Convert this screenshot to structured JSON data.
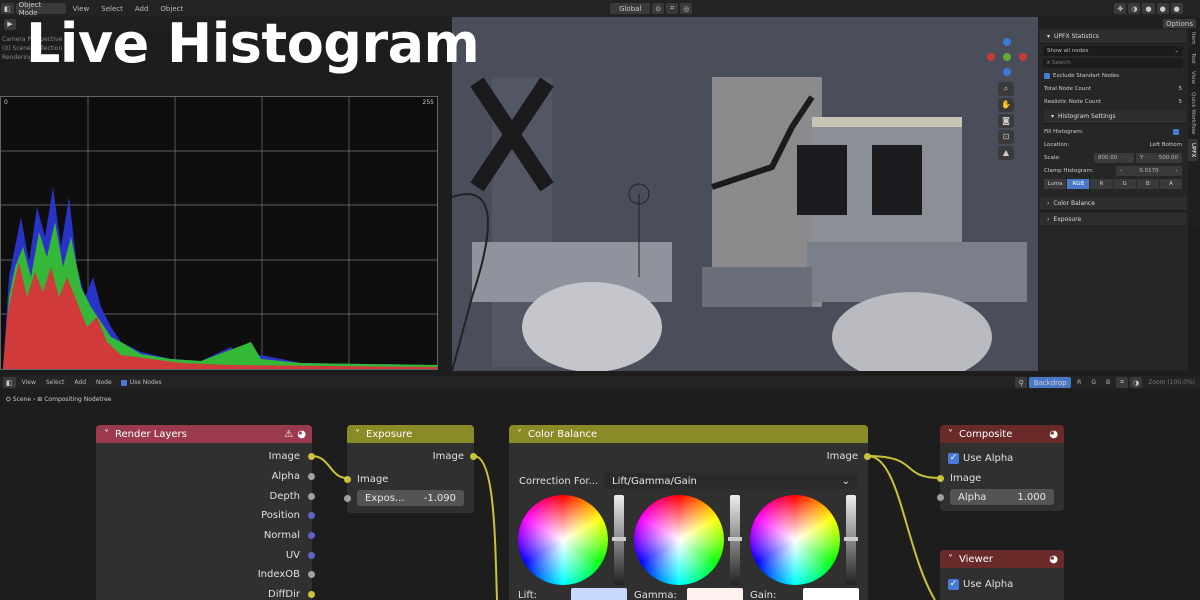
{
  "header": {
    "mode": "Object Mode",
    "menu": [
      "View",
      "Select",
      "Add",
      "Object"
    ],
    "orientation": "Global",
    "options": "Options"
  },
  "overlay": {
    "line1": "Camera Perspective",
    "line2": "(0) Scene Collection |",
    "line3": "Rendering"
  },
  "title": "Live Histogram",
  "histogram": {
    "min": "0",
    "max": "255"
  },
  "npanel": {
    "title": "UPFX Statistics",
    "show": "Show all nodes",
    "search_placeholder": "Search",
    "exclude": "Exclude Standart Nodes",
    "total_label": "Total Node Count",
    "total_value": "5",
    "real_label": "Realistic Node Count",
    "real_value": "5",
    "hist_settings": "Histogram Settings",
    "fill": "Fill Histogram:",
    "location_label": "Location:",
    "location_value": "Left Bottom",
    "scale_label": "Scale:",
    "scale_x": "800.00",
    "scale_y_label": "Y",
    "scale_y": "500.00",
    "clamp_label": "Clamp Histogram:",
    "clamp_value": "0.0170",
    "tabs": [
      "Luma",
      "RGB",
      "R",
      "G",
      "B",
      "A"
    ],
    "color_balance": "Color Balance",
    "exposure": "Exposure",
    "vtabs": [
      "Item",
      "Tool",
      "View",
      "Quick Workflow",
      "UPFX"
    ]
  },
  "node_header": {
    "menu": [
      "View",
      "Select",
      "Add",
      "Node"
    ],
    "use_nodes": "Use Nodes",
    "backdrop": "Backdrop",
    "channels": [
      "R",
      "G",
      "B"
    ],
    "zoom": "Zoom (100.0%)"
  },
  "breadcrumb": {
    "scene": "Scene",
    "tree": "Compositing Nodetree"
  },
  "nodes": {
    "render_layers": {
      "title": "Render Layers",
      "outputs": [
        "Image",
        "Alpha",
        "Depth",
        "Position",
        "Normal",
        "UV",
        "IndexOB",
        "DiffDir"
      ]
    },
    "exposure": {
      "title": "Exposure",
      "out": "Image",
      "in": "Image",
      "field_label": "Expos...",
      "field_value": "-1.090"
    },
    "color_balance": {
      "title": "Color Balance",
      "out": "Image",
      "corr_label": "Correction For...",
      "corr_value": "Lift/Gamma/Gain",
      "lift": "Lift:",
      "gamma": "Gamma:",
      "gain": "Gain:"
    },
    "composite": {
      "title": "Composite",
      "use_alpha": "Use Alpha",
      "in": "Image",
      "alpha_label": "Alpha",
      "alpha_value": "1.000"
    },
    "viewer": {
      "title": "Viewer",
      "use_alpha": "Use Alpha"
    }
  },
  "colors": {
    "render_layers": "#9a3a4c",
    "exposure": "#8a8a26",
    "color_balance": "#8a8a26",
    "output": "#6b2a2a"
  }
}
